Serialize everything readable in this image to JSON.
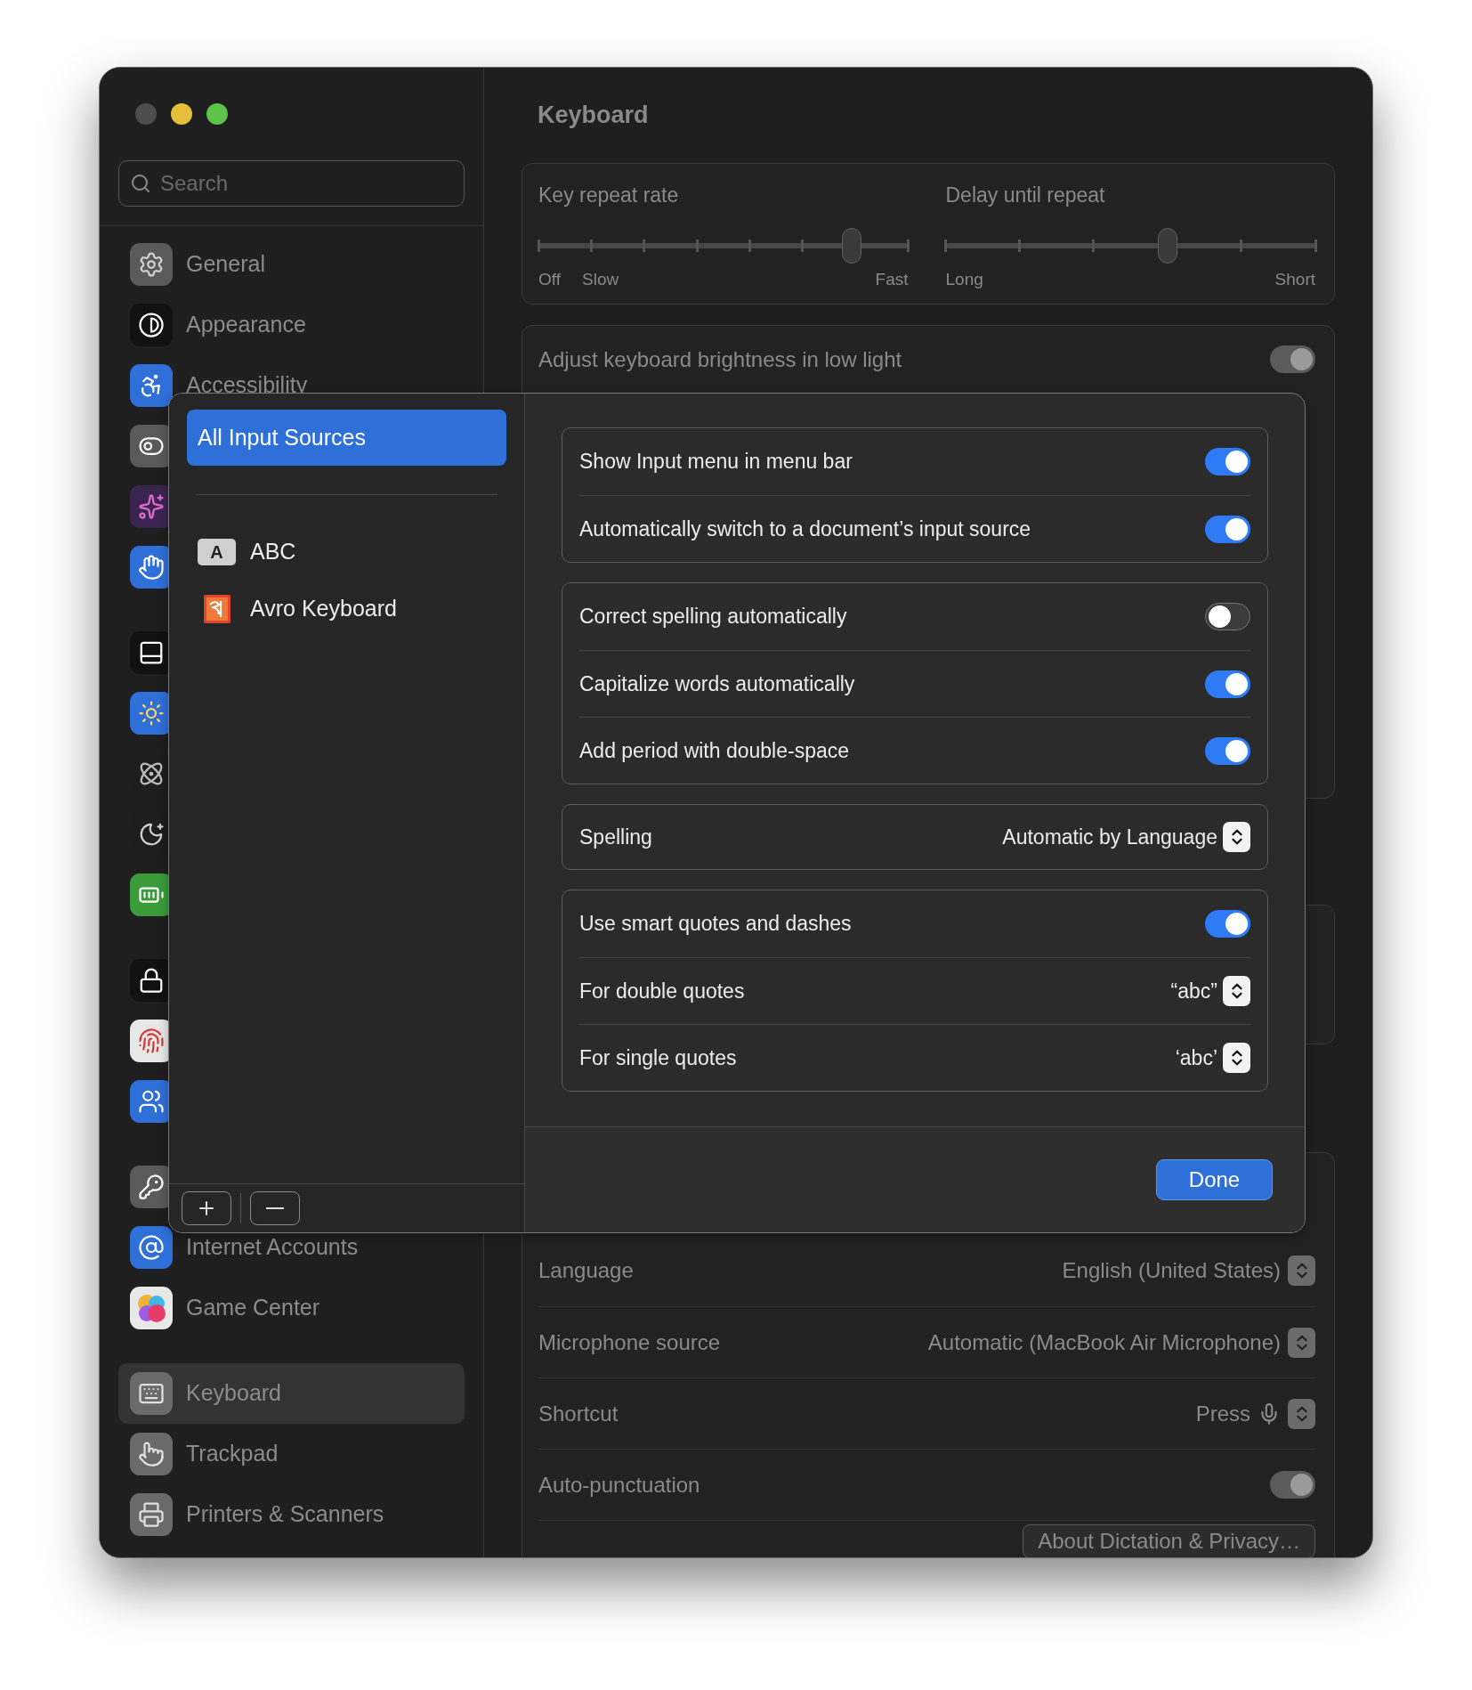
{
  "sidebar": {
    "search": {
      "placeholder": "Search"
    },
    "groups": [
      [
        {
          "label": "General",
          "selected": false
        },
        {
          "label": "Appearance",
          "selected": false
        },
        {
          "label": "Accessibility",
          "selected": false
        },
        {
          "selected": false
        },
        {
          "selected": false
        },
        {
          "selected": false
        }
      ],
      [
        {
          "selected": false
        },
        {
          "selected": false
        },
        {
          "selected": false
        },
        {
          "selected": false
        },
        {
          "selected": false
        }
      ],
      [
        {
          "selected": false
        },
        {
          "selected": false
        },
        {
          "selected": false
        }
      ],
      [
        {
          "selected": false
        },
        {
          "label": "Internet Accounts",
          "selected": false
        },
        {
          "label": "Game Center",
          "selected": false
        }
      ],
      [
        {
          "label": "Keyboard",
          "selected": true
        },
        {
          "label": "Trackpad",
          "selected": false
        },
        {
          "label": "Printers & Scanners",
          "selected": false
        }
      ]
    ]
  },
  "main": {
    "title": "Keyboard",
    "sliders": [
      {
        "label": "Key repeat rate",
        "level": 0.846,
        "left_labels": [
          "Off",
          "Slow"
        ],
        "right_label": "Fast"
      },
      {
        "label": "Delay until repeat",
        "level": 0.6,
        "left_labels": [
          "Long"
        ],
        "right_label": "Short"
      }
    ],
    "brightness": {
      "label": "Adjust keyboard brightness in low light",
      "on": true
    },
    "dictation": {
      "rows": [
        {
          "kind": "select",
          "label": "Language",
          "value": "English (United States)"
        },
        {
          "kind": "select",
          "label": "Microphone source",
          "value": "Automatic (MacBook Air Microphone)"
        },
        {
          "kind": "shortcut",
          "label": "Shortcut",
          "value": "Press"
        },
        {
          "kind": "toggle",
          "label": "Auto-punctuation",
          "on": true
        }
      ],
      "button": "About Dictation & Privacy…"
    }
  },
  "sheet": {
    "sources": [
      {
        "label": "All Input Sources",
        "selected": true
      },
      {
        "label": "ABC",
        "icon_letter": "A",
        "selected": false
      },
      {
        "label": "Avro Keyboard",
        "selected": false
      }
    ],
    "groups": [
      [
        {
          "kind": "toggle",
          "label": "Show Input menu in menu bar",
          "on": true
        },
        {
          "kind": "toggle",
          "label": "Automatically switch to a document’s input source",
          "on": true
        }
      ],
      [
        {
          "kind": "toggle",
          "label": "Correct spelling automatically",
          "on": false
        },
        {
          "kind": "toggle",
          "label": "Capitalize words automatically",
          "on": true
        },
        {
          "kind": "toggle",
          "label": "Add period with double-space",
          "on": true
        }
      ],
      [
        {
          "kind": "select",
          "label": "Spelling",
          "value": "Automatic by Language"
        }
      ],
      [
        {
          "kind": "toggle",
          "label": "Use smart quotes and dashes",
          "on": true
        },
        {
          "kind": "select",
          "label": "For double quotes",
          "value": "“abc”"
        },
        {
          "kind": "select",
          "label": "For single quotes",
          "value": "‘abc’"
        }
      ]
    ],
    "done": "Done"
  }
}
